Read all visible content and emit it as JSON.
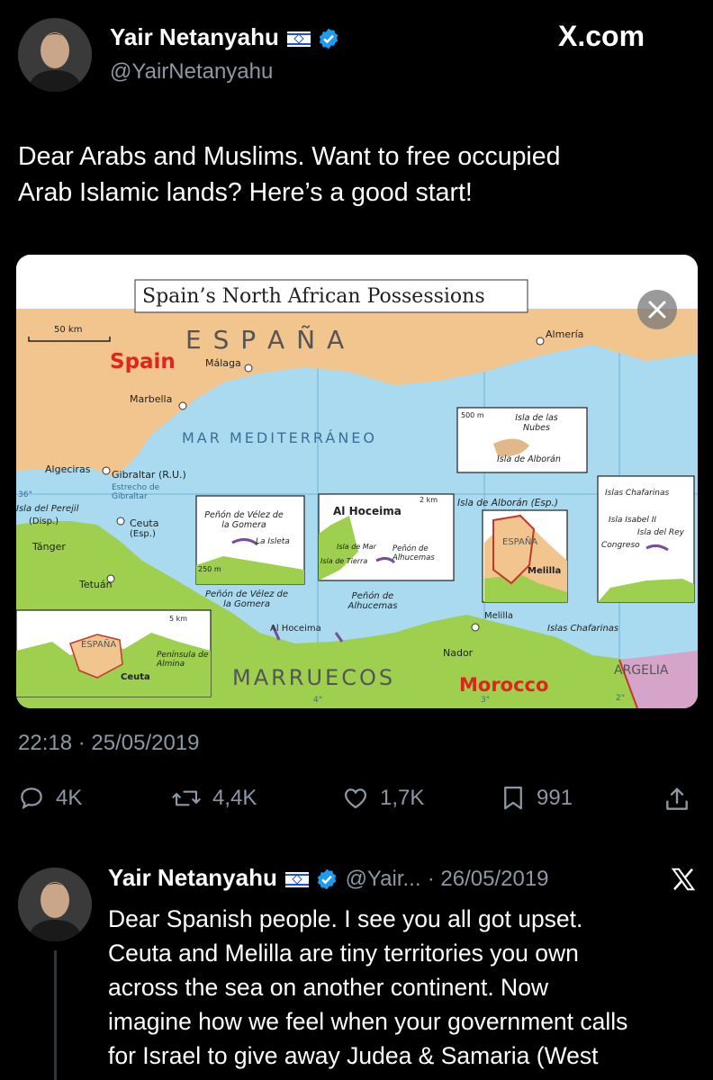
{
  "header": {
    "brand": "X.com"
  },
  "main_tweet": {
    "author": {
      "name": "Yair Netanyahu",
      "handle": "@YairNetanyahu"
    },
    "text_lines": [
      "Dear Arabs and Muslims. Want to free occupied",
      "Arab Islamic lands? Here’s a good start!"
    ],
    "timestamp": "22:18 · 25/05/2019",
    "stats": {
      "replies": "4K",
      "reposts": "4,4K",
      "likes": "1,7K",
      "bookmarks": "991"
    }
  },
  "map": {
    "title": "Spain’s North African Possessions",
    "scale_main": "50 km",
    "espana": "E S P A Ñ A",
    "spain": "Spain",
    "malaga": "Málaga",
    "almeria": "Almería",
    "marbella": "Marbella",
    "mar": "MAR MEDITERRÁNEO",
    "algeciras": "Algeciras",
    "gibraltar": "Gibraltar (R.U.)",
    "estrecho": "Estrecho de Gibraltar",
    "deg36": "36°",
    "perejil": "Isla del Perejil",
    "disp": "(Disp.)",
    "ceuta": "Ceuta",
    "esp": "(Esp.)",
    "tanger": "Tánger",
    "tetuan": "Tetuán",
    "velez_inset_title": "Peñón de Vélez de la Gomera",
    "la_isleta": "La Isleta",
    "scale_250m": "250 m",
    "velez_label": "Peñón de Vélez de la Gomera",
    "hoceima_title": "Al Hoceima",
    "scale_2km": "2 km",
    "isla_de_tierra": "Isla de Tierra",
    "isla_de_mar": "Isla de Mar",
    "penon_alhucemas_inset": "Peñón de Alhucemas",
    "marruecos_small": "MARRUECOS",
    "al_hoceima": "Al Hoceima",
    "penon_alhucemas": "Peñón de Alhucemas",
    "nubes": "Isla de las Nubes",
    "scale_500m": "500 m",
    "isla_alboran_inset": "Isla de Alborán",
    "isla_alboran": "Isla de Alborán (Esp.)",
    "melilla_espana": "ESPAÑA",
    "melilla_inset": "Melilla",
    "chafarinas_title": "Islas Chafarinas",
    "isabel": "Isla Isabel II",
    "isla_del_rey": "Isla del Rey",
    "congreso": "Congreso",
    "melilla": "Melilla",
    "nador": "Nador",
    "chafarinas": "Islas Chafarinas",
    "ceuta_espana": "ESPAÑA",
    "scale_5km": "5 km",
    "peninsula": "Península de Almina",
    "ceuta_inset": "Ceuta",
    "marruecos": "MARRUECOS",
    "morocco": "Morocco",
    "argelia": "ARGELIA",
    "deg4": "4°",
    "deg3": "3°",
    "deg2": "2°"
  },
  "reply_tweet": {
    "author": {
      "name": "Yair Netanyahu",
      "handle": "@Yair...",
      "date": "· 26/05/2019"
    },
    "text_lines": [
      "Dear Spanish people. I see you all got upset.",
      "Ceuta and Melilla are tiny territories you own",
      "across the sea on another continent. Now",
      "imagine how we feel when your government calls",
      "for Israel to give away Judea & Samaria (West"
    ]
  },
  "colors": {
    "background": "#000000",
    "verified": "#1d9bf0",
    "secondary_text": "#8b98a5",
    "sea": "#a9daf0",
    "land_spain": "#f2c48e",
    "land_morocco": "#9ecf4f"
  }
}
